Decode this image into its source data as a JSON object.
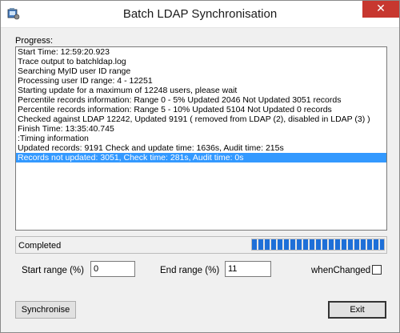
{
  "window": {
    "title": "Batch LDAP Synchronisation",
    "close_glyph": "✕",
    "icon": "app-icon"
  },
  "progress_label": "Progress:",
  "log": {
    "lines": [
      "Start Time: 12:59:20.923",
      "Trace output to batchldap.log",
      "Searching MyID user ID range",
      "Processing user ID range: 4 - 12251",
      "Starting update for a maximum of 12248 users, please wait",
      "Percentile records information: Range 0 - 5% Updated 2046 Not Updated 3051 records",
      "Percentile records information: Range 5 - 10% Updated 5104 Not Updated 0 records",
      "Checked against LDAP 12242, Updated 9191 ( removed from LDAP (2), disabled in LDAP (3) )",
      "Finish Time: 13:35:40.745",
      " :Timing information",
      "Updated records: 9191 Check and update time: 1636s,  Audit time: 215s",
      "Records not updated: 3051, Check time: 281s,  Audit time: 0s"
    ],
    "selected_index": 11
  },
  "status": {
    "text": "Completed",
    "progress_fraction": 1.0,
    "progress_color": "#1e6fd8"
  },
  "fields": {
    "start_range_label": "Start range (%)",
    "start_range_value": "0",
    "end_range_label": "End range (%)",
    "end_range_value": "11",
    "when_changed_label": "whenChanged",
    "when_changed_checked": false
  },
  "buttons": {
    "synchronise": "Synchronise",
    "exit": "Exit"
  }
}
